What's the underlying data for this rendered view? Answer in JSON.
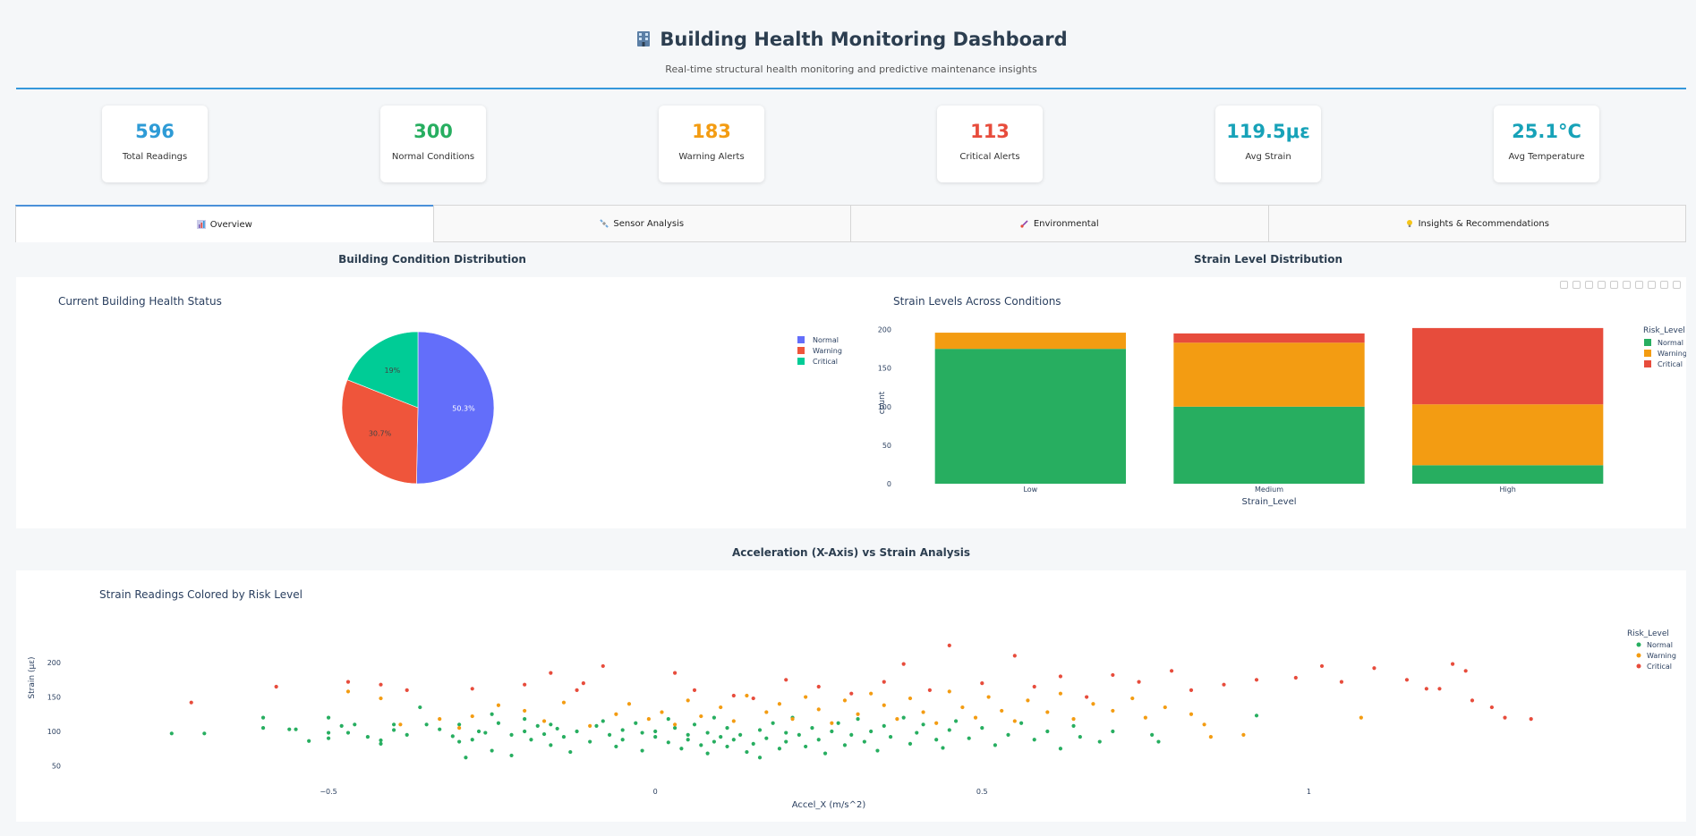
{
  "header": {
    "icon": "building-icon",
    "title": "Building Health Monitoring Dashboard",
    "subtitle": "Real-time structural health monitoring and predictive maintenance insights"
  },
  "kpis": [
    {
      "value": "596",
      "label": "Total Readings",
      "color": "#2e9bd6"
    },
    {
      "value": "300",
      "label": "Normal Conditions",
      "color": "#27ae60"
    },
    {
      "value": "183",
      "label": "Warning Alerts",
      "color": "#f39c12"
    },
    {
      "value": "113",
      "label": "Critical Alerts",
      "color": "#e74c3c"
    },
    {
      "value": "119.5με",
      "label": "Avg Strain",
      "color": "#17a2b8"
    },
    {
      "value": "25.1°C",
      "label": "Avg Temperature",
      "color": "#17a2b8"
    }
  ],
  "tabs": [
    {
      "label": "Overview",
      "icon": "bar-chart-icon",
      "active": true
    },
    {
      "label": "Sensor Analysis",
      "icon": "satellite-icon",
      "active": false
    },
    {
      "label": "Environmental",
      "icon": "thermometer-icon",
      "active": false
    },
    {
      "label": "Insights & Recommendations",
      "icon": "lightbulb-icon",
      "active": false
    }
  ],
  "sections": {
    "condition": "Building Condition Distribution",
    "strain": "Strain Level Distribution",
    "accel": "Acceleration (X-Axis) vs Strain Analysis"
  },
  "colors": {
    "normal": "#27ae60",
    "warning": "#f39c12",
    "critical": "#e74c3c",
    "pie_normal": "#636efa",
    "pie_warning": "#ef553b",
    "pie_critical": "#00cc96"
  },
  "chart_data": [
    {
      "type": "pie",
      "title": "Current Building Health Status",
      "labels": [
        "Normal",
        "Warning",
        "Critical"
      ],
      "values": [
        50.3,
        30.7,
        19
      ],
      "value_labels": [
        "50.3%",
        "30.7%",
        "19%"
      ],
      "legend": "right"
    },
    {
      "type": "bar",
      "stacked": true,
      "title": "Strain Levels Across Conditions",
      "xlabel": "Strain_Level",
      "ylabel": "count",
      "categories": [
        "Low",
        "Medium",
        "High"
      ],
      "yticks": [
        0,
        50,
        100,
        150,
        200
      ],
      "ylim": [
        0,
        210
      ],
      "legend_title": "Risk_Level",
      "series": [
        {
          "name": "Normal",
          "values": [
            175,
            100,
            24
          ]
        },
        {
          "name": "Warning",
          "values": [
            21,
            83,
            79
          ]
        },
        {
          "name": "Critical",
          "values": [
            0,
            12,
            99
          ]
        }
      ]
    },
    {
      "type": "scatter",
      "title": "Strain Readings Colored by Risk Level",
      "xlabel": "Accel_X (m/s^2)",
      "ylabel": "Strain (με)",
      "xticks": [
        -0.5,
        0,
        0.5,
        1
      ],
      "yticks": [
        50,
        100,
        150,
        200
      ],
      "xlim": [
        -0.8,
        1.35
      ],
      "ylim": [
        35,
        230
      ],
      "legend_title": "Risk_Level",
      "series": [
        {
          "name": "Normal",
          "points": [
            [
              -0.74,
              97
            ],
            [
              -0.69,
              97
            ],
            [
              -0.6,
              105
            ],
            [
              -0.6,
              120
            ],
            [
              -0.56,
              103
            ],
            [
              -0.55,
              103
            ],
            [
              -0.53,
              86
            ],
            [
              -0.5,
              90
            ],
            [
              -0.5,
              98
            ],
            [
              -0.5,
              120
            ],
            [
              -0.48,
              108
            ],
            [
              -0.47,
              98
            ],
            [
              -0.46,
              110
            ],
            [
              -0.44,
              92
            ],
            [
              -0.42,
              87
            ],
            [
              -0.42,
              82
            ],
            [
              -0.4,
              110
            ],
            [
              -0.4,
              102
            ],
            [
              -0.38,
              95
            ],
            [
              -0.36,
              135
            ],
            [
              -0.35,
              110
            ],
            [
              -0.33,
              103
            ],
            [
              -0.31,
              93
            ],
            [
              -0.3,
              110
            ],
            [
              -0.3,
              85
            ],
            [
              -0.29,
              62
            ],
            [
              -0.28,
              88
            ],
            [
              -0.27,
              100
            ],
            [
              -0.26,
              98
            ],
            [
              -0.25,
              125
            ],
            [
              -0.25,
              72
            ],
            [
              -0.24,
              112
            ],
            [
              -0.22,
              95
            ],
            [
              -0.22,
              65
            ],
            [
              -0.2,
              118
            ],
            [
              -0.2,
              100
            ],
            [
              -0.19,
              88
            ],
            [
              -0.18,
              108
            ],
            [
              -0.17,
              96
            ],
            [
              -0.16,
              110
            ],
            [
              -0.16,
              80
            ],
            [
              -0.15,
              104
            ],
            [
              -0.14,
              92
            ],
            [
              -0.13,
              70
            ],
            [
              -0.12,
              100
            ],
            [
              -0.1,
              85
            ],
            [
              -0.09,
              108
            ],
            [
              -0.08,
              115
            ],
            [
              -0.07,
              95
            ],
            [
              -0.06,
              78
            ],
            [
              -0.05,
              102
            ],
            [
              -0.05,
              88
            ],
            [
              -0.03,
              112
            ],
            [
              -0.02,
              98
            ],
            [
              -0.02,
              72
            ],
            [
              0,
              100
            ],
            [
              0,
              92
            ],
            [
              0.02,
              84
            ],
            [
              0.02,
              118
            ],
            [
              0.03,
              105
            ],
            [
              0.04,
              75
            ],
            [
              0.05,
              95
            ],
            [
              0.05,
              88
            ],
            [
              0.06,
              110
            ],
            [
              0.07,
              80
            ],
            [
              0.08,
              98
            ],
            [
              0.08,
              68
            ],
            [
              0.09,
              120
            ],
            [
              0.09,
              85
            ],
            [
              0.1,
              92
            ],
            [
              0.11,
              78
            ],
            [
              0.11,
              105
            ],
            [
              0.12,
              88
            ],
            [
              0.13,
              95
            ],
            [
              0.14,
              70
            ],
            [
              0.15,
              82
            ],
            [
              0.16,
              102
            ],
            [
              0.16,
              62
            ],
            [
              0.17,
              90
            ],
            [
              0.18,
              112
            ],
            [
              0.19,
              75
            ],
            [
              0.2,
              98
            ],
            [
              0.2,
              85
            ],
            [
              0.21,
              120
            ],
            [
              0.22,
              95
            ],
            [
              0.23,
              78
            ],
            [
              0.24,
              105
            ],
            [
              0.25,
              88
            ],
            [
              0.26,
              68
            ],
            [
              0.27,
              100
            ],
            [
              0.28,
              112
            ],
            [
              0.29,
              80
            ],
            [
              0.3,
              95
            ],
            [
              0.31,
              118
            ],
            [
              0.32,
              85
            ],
            [
              0.33,
              100
            ],
            [
              0.34,
              72
            ],
            [
              0.35,
              108
            ],
            [
              0.36,
              92
            ],
            [
              0.38,
              120
            ],
            [
              0.39,
              82
            ],
            [
              0.4,
              98
            ],
            [
              0.41,
              110
            ],
            [
              0.43,
              88
            ],
            [
              0.44,
              76
            ],
            [
              0.45,
              102
            ],
            [
              0.46,
              115
            ],
            [
              0.48,
              90
            ],
            [
              0.5,
              105
            ],
            [
              0.52,
              80
            ],
            [
              0.54,
              95
            ],
            [
              0.56,
              112
            ],
            [
              0.58,
              88
            ],
            [
              0.6,
              100
            ],
            [
              0.62,
              75
            ],
            [
              0.64,
              108
            ],
            [
              0.65,
              92
            ],
            [
              0.68,
              85
            ],
            [
              0.7,
              100
            ],
            [
              0.76,
              95
            ],
            [
              0.77,
              85
            ],
            [
              0.92,
              123
            ]
          ]
        },
        {
          "name": "Warning",
          "points": [
            [
              -0.47,
              158
            ],
            [
              -0.42,
              148
            ],
            [
              -0.39,
              110
            ],
            [
              -0.33,
              118
            ],
            [
              -0.3,
              105
            ],
            [
              -0.28,
              122
            ],
            [
              -0.24,
              138
            ],
            [
              -0.2,
              130
            ],
            [
              -0.17,
              115
            ],
            [
              -0.14,
              142
            ],
            [
              -0.1,
              108
            ],
            [
              -0.06,
              125
            ],
            [
              -0.04,
              140
            ],
            [
              -0.01,
              118
            ],
            [
              0.01,
              128
            ],
            [
              0.03,
              110
            ],
            [
              0.05,
              145
            ],
            [
              0.07,
              122
            ],
            [
              0.1,
              135
            ],
            [
              0.12,
              115
            ],
            [
              0.14,
              152
            ],
            [
              0.17,
              128
            ],
            [
              0.19,
              140
            ],
            [
              0.21,
              118
            ],
            [
              0.23,
              150
            ],
            [
              0.25,
              132
            ],
            [
              0.27,
              112
            ],
            [
              0.29,
              145
            ],
            [
              0.31,
              125
            ],
            [
              0.33,
              155
            ],
            [
              0.35,
              138
            ],
            [
              0.37,
              118
            ],
            [
              0.39,
              148
            ],
            [
              0.41,
              128
            ],
            [
              0.43,
              112
            ],
            [
              0.45,
              158
            ],
            [
              0.47,
              135
            ],
            [
              0.49,
              120
            ],
            [
              0.51,
              150
            ],
            [
              0.53,
              130
            ],
            [
              0.55,
              115
            ],
            [
              0.57,
              145
            ],
            [
              0.6,
              128
            ],
            [
              0.62,
              155
            ],
            [
              0.64,
              118
            ],
            [
              0.67,
              140
            ],
            [
              0.7,
              130
            ],
            [
              0.73,
              148
            ],
            [
              0.75,
              120
            ],
            [
              0.78,
              135
            ],
            [
              0.82,
              125
            ],
            [
              0.84,
              110
            ],
            [
              0.85,
              92
            ],
            [
              0.9,
              95
            ],
            [
              1.08,
              120
            ]
          ]
        },
        {
          "name": "Critical",
          "points": [
            [
              -0.71,
              142
            ],
            [
              -0.58,
              165
            ],
            [
              -0.47,
              172
            ],
            [
              -0.42,
              168
            ],
            [
              -0.38,
              160
            ],
            [
              -0.28,
              162
            ],
            [
              -0.2,
              168
            ],
            [
              -0.16,
              185
            ],
            [
              -0.12,
              160
            ],
            [
              -0.11,
              170
            ],
            [
              -0.08,
              195
            ],
            [
              0.03,
              185
            ],
            [
              0.06,
              160
            ],
            [
              0.12,
              152
            ],
            [
              0.15,
              148
            ],
            [
              0.2,
              175
            ],
            [
              0.25,
              165
            ],
            [
              0.3,
              155
            ],
            [
              0.35,
              172
            ],
            [
              0.38,
              198
            ],
            [
              0.42,
              160
            ],
            [
              0.45,
              225
            ],
            [
              0.5,
              170
            ],
            [
              0.55,
              210
            ],
            [
              0.58,
              165
            ],
            [
              0.62,
              180
            ],
            [
              0.66,
              150
            ],
            [
              0.7,
              182
            ],
            [
              0.74,
              172
            ],
            [
              0.79,
              188
            ],
            [
              0.82,
              160
            ],
            [
              0.87,
              168
            ],
            [
              0.92,
              175
            ],
            [
              0.98,
              178
            ],
            [
              1.02,
              195
            ],
            [
              1.05,
              172
            ],
            [
              1.1,
              192
            ],
            [
              1.15,
              175
            ],
            [
              1.18,
              162
            ],
            [
              1.2,
              162
            ],
            [
              1.22,
              198
            ],
            [
              1.24,
              188
            ],
            [
              1.25,
              145
            ],
            [
              1.28,
              135
            ],
            [
              1.3,
              120
            ],
            [
              1.34,
              118
            ]
          ]
        }
      ]
    }
  ]
}
